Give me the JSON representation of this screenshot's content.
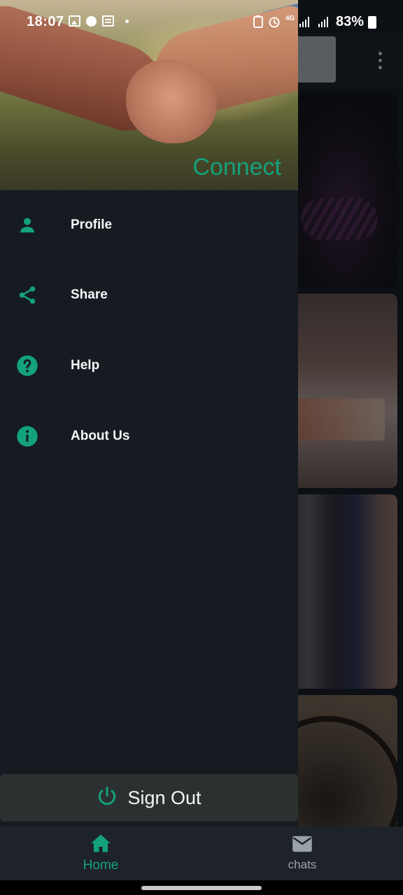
{
  "status_bar": {
    "time": "18:07",
    "network": "4G",
    "battery": "83%"
  },
  "drawer": {
    "header_title": "Connect",
    "menu_items": [
      {
        "label": "Profile",
        "icon": "person-icon"
      },
      {
        "label": "Share",
        "icon": "share-icon"
      },
      {
        "label": "Help",
        "icon": "help-circle-icon"
      },
      {
        "label": "About Us",
        "icon": "info-circle-icon"
      }
    ],
    "sign_out_label": "Sign Out"
  },
  "bottom_nav": {
    "items": [
      {
        "label": "Home",
        "icon": "home-icon",
        "active": true
      },
      {
        "label": "chats",
        "icon": "mail-icon",
        "active": false
      }
    ]
  },
  "colors": {
    "accent": "#14a27b",
    "drawer_bg": "#151b21",
    "nav_bg": "#1d2329",
    "signout_bg": "#2b3030"
  }
}
